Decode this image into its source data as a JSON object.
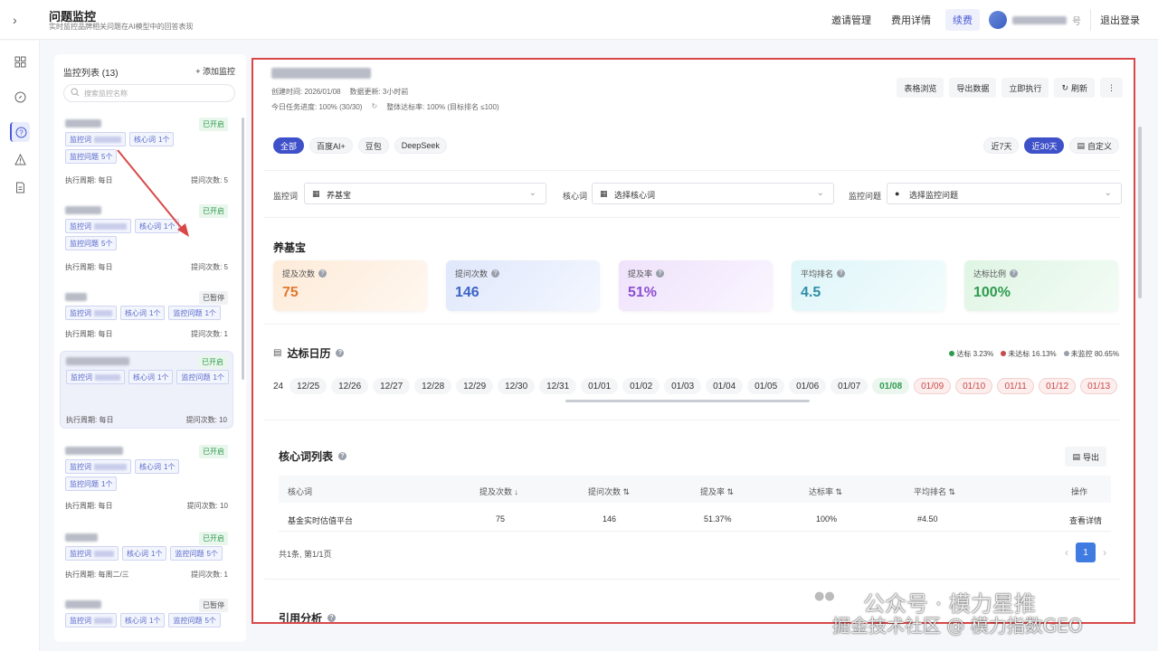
{
  "app": {
    "title": "问题监控",
    "subtitle": "实时监控品牌相关问题在AI模型中的回答表现"
  },
  "topnav": {
    "invite": "邀请管理",
    "billing": "费用详情",
    "renew": "续费",
    "user_suffix": "号",
    "logout": "退出登录"
  },
  "left": {
    "list_title": "监控列表 (13)",
    "add_label": "添加监控",
    "search_placeholder": "搜索监控名称",
    "cards": [
      {
        "status": "已开启",
        "status_kind": "on",
        "tags": [
          {
            "k": "监控词",
            "v": ""
          },
          {
            "k": "核心词",
            "v": "1个"
          },
          {
            "k": "监控问题",
            "v": "5个"
          }
        ],
        "period": "执行周期: 每日",
        "count": "提问次数: 5"
      },
      {
        "status": "已开启",
        "status_kind": "on",
        "tags": [
          {
            "k": "监控词",
            "v": ""
          },
          {
            "k": "核心词",
            "v": "1个"
          },
          {
            "k": "监控问题",
            "v": "5个"
          }
        ],
        "period": "执行周期: 每日",
        "count": "提问次数: 5"
      },
      {
        "status": "已暂停",
        "status_kind": "off",
        "tags": [
          {
            "k": "监控词",
            "v": ""
          },
          {
            "k": "核心词",
            "v": "1个"
          },
          {
            "k": "监控问题",
            "v": "1个"
          }
        ],
        "period": "执行周期: 每日",
        "count": "提问次数: 1"
      },
      {
        "status": "已开启",
        "status_kind": "on",
        "tags": [
          {
            "k": "监控词",
            "v": ""
          },
          {
            "k": "核心词",
            "v": "1个"
          },
          {
            "k": "监控问题",
            "v": "1个"
          }
        ],
        "period": "执行周期: 每日",
        "count": "提问次数: 10"
      },
      {
        "status": "已开启",
        "status_kind": "on",
        "tags": [
          {
            "k": "监控词",
            "v": ""
          },
          {
            "k": "核心词",
            "v": "1个"
          },
          {
            "k": "监控问题",
            "v": "1个"
          }
        ],
        "period": "执行周期: 每日",
        "count": "提问次数: 10"
      },
      {
        "status": "已开启",
        "status_kind": "on",
        "tags": [
          {
            "k": "监控词",
            "v": ""
          },
          {
            "k": "核心词",
            "v": "1个"
          },
          {
            "k": "监控问题",
            "v": "5个"
          }
        ],
        "period": "执行周期: 每周二/三",
        "count": "提问次数: 1"
      },
      {
        "status": "已暂停",
        "status_kind": "off",
        "tags": [
          {
            "k": "监控词",
            "v": ""
          },
          {
            "k": "核心词",
            "v": "1个"
          },
          {
            "k": "监控问题",
            "v": "5个"
          }
        ],
        "period": "",
        "count": ""
      }
    ]
  },
  "detail": {
    "created": "创建时间: 2026/01/08",
    "updated": "数据更新: 3小时前",
    "progress": "今日任务进度: 100% (30/30)",
    "reach": "整体达标率: 100% (目标排名 ≤100)",
    "actions": [
      "表格浏览",
      "导出数据",
      "立即执行",
      "刷新"
    ],
    "models": [
      "全部",
      "百度AI+",
      "豆包",
      "DeepSeek"
    ],
    "ranges": [
      "近7天",
      "近30天",
      "自定义"
    ],
    "filters": {
      "monitor_label": "监控词",
      "monitor_value": "养基宝",
      "core_label": "核心词",
      "core_value": "选择核心词",
      "question_label": "监控问题",
      "question_value": "选择监控问题"
    }
  },
  "kpi": {
    "title": "养基宝",
    "items": [
      {
        "label": "提及次数",
        "value": "75",
        "color": "#e07a2e",
        "bg": "linear-gradient(135deg,#fdebd9,#fff7ef)"
      },
      {
        "label": "提问次数",
        "value": "146",
        "color": "#3d64c4",
        "bg": "linear-gradient(135deg,#dfe7fb,#f4f7ff)"
      },
      {
        "label": "提及率",
        "value": "51%",
        "color": "#8a4fd0",
        "bg": "linear-gradient(135deg,#efe2fb,#faf5ff)"
      },
      {
        "label": "平均排名",
        "value": "4.5",
        "color": "#2e8ea8",
        "bg": "linear-gradient(135deg,#def5f8,#f3fcfd)"
      },
      {
        "label": "达标比例",
        "value": "100%",
        "color": "#2e9b4d",
        "bg": "linear-gradient(135deg,#dff5e4,#f3fcf5)"
      }
    ]
  },
  "calendar": {
    "title": "达标日历",
    "legend": {
      "ok": "达标 3.23%",
      "fail": "未达标 16.13%",
      "none": "未监控 80.65%"
    },
    "dates": [
      {
        "d": "24",
        "s": "cut"
      },
      {
        "d": "12/25",
        "s": ""
      },
      {
        "d": "12/26",
        "s": ""
      },
      {
        "d": "12/27",
        "s": ""
      },
      {
        "d": "12/28",
        "s": ""
      },
      {
        "d": "12/29",
        "s": ""
      },
      {
        "d": "12/30",
        "s": ""
      },
      {
        "d": "12/31",
        "s": ""
      },
      {
        "d": "01/01",
        "s": ""
      },
      {
        "d": "01/02",
        "s": ""
      },
      {
        "d": "01/03",
        "s": ""
      },
      {
        "d": "01/04",
        "s": ""
      },
      {
        "d": "01/05",
        "s": ""
      },
      {
        "d": "01/06",
        "s": ""
      },
      {
        "d": "01/07",
        "s": ""
      },
      {
        "d": "01/08",
        "s": "green"
      },
      {
        "d": "01/09",
        "s": "red"
      },
      {
        "d": "01/10",
        "s": "red"
      },
      {
        "d": "01/11",
        "s": "red"
      },
      {
        "d": "01/12",
        "s": "red"
      },
      {
        "d": "01/13",
        "s": "red"
      }
    ]
  },
  "core": {
    "title": "核心词列表",
    "export": "导出",
    "headers": [
      "核心词",
      "提及次数 ↓",
      "提问次数 ⇅",
      "提及率 ⇅",
      "达标率 ⇅",
      "平均排名 ⇅",
      "操作"
    ],
    "row": [
      "基金实时估值平台",
      "75",
      "146",
      "51.37%",
      "100%",
      "#4.50",
      "查看详情"
    ],
    "pager": "共1条, 第1/1页",
    "page": "1"
  },
  "ref": {
    "title": "引用分析"
  },
  "watermark": {
    "line1": "公众号 · 模力星推",
    "line2": "掘金技术社区 @ 模力指数GEO"
  },
  "colors": {
    "accent": "#3f51c9",
    "highlight_border": "#d94848",
    "ok": "#2e9b4d",
    "fail": "#c84a4a",
    "none": "#9aa0ab"
  }
}
